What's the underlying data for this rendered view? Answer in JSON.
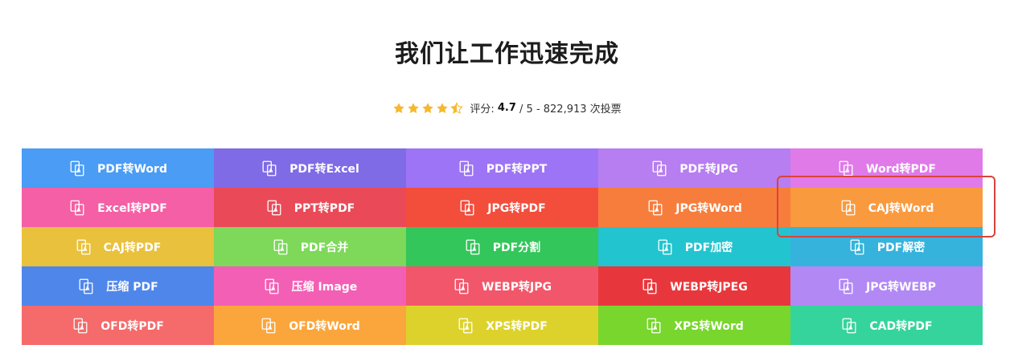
{
  "header": {
    "title": "我们让工作迅速完成"
  },
  "rating": {
    "stars": 4.5,
    "label": "评分:",
    "score": "4.7",
    "out_of": "/ 5 - 822,913 次投票"
  },
  "tools": [
    {
      "label": "PDF转Word",
      "color": "#4a9cf5",
      "icon": "pdf-to-word-icon"
    },
    {
      "label": "PDF转Excel",
      "color": "#7f6be6",
      "icon": "pdf-to-excel-icon"
    },
    {
      "label": "PDF转PPT",
      "color": "#9d74f5",
      "icon": "pdf-to-ppt-icon"
    },
    {
      "label": "PDF转JPG",
      "color": "#b67ef0",
      "icon": "pdf-to-jpg-icon"
    },
    {
      "label": "Word转PDF",
      "color": "#e07ae8",
      "icon": "word-to-pdf-icon"
    },
    {
      "label": "Excel转PDF",
      "color": "#f45fa5",
      "icon": "excel-to-pdf-icon"
    },
    {
      "label": "PPT转PDF",
      "color": "#ea4a58",
      "icon": "ppt-to-pdf-icon"
    },
    {
      "label": "JPG转PDF",
      "color": "#f34d3c",
      "icon": "jpg-to-pdf-icon"
    },
    {
      "label": "JPG转Word",
      "color": "#f77d3c",
      "icon": "jpg-to-word-icon"
    },
    {
      "label": "CAJ转Word",
      "color": "#fa9a3e",
      "icon": "caj-to-word-icon"
    },
    {
      "label": "CAJ转PDF",
      "color": "#e9c13d",
      "icon": "caj-to-pdf-icon"
    },
    {
      "label": "PDF合并",
      "color": "#7ed85a",
      "icon": "pdf-merge-icon"
    },
    {
      "label": "PDF分割",
      "color": "#33c65a",
      "icon": "pdf-split-icon"
    },
    {
      "label": "PDF加密",
      "color": "#22c4cf",
      "icon": "pdf-encrypt-icon"
    },
    {
      "label": "PDF解密",
      "color": "#35b3dc",
      "icon": "pdf-decrypt-icon"
    },
    {
      "label": "压缩 PDF",
      "color": "#4f86ea",
      "icon": "compress-pdf-icon"
    },
    {
      "label": "压缩 Image",
      "color": "#f35fb4",
      "icon": "compress-image-icon"
    },
    {
      "label": "WEBP转JPG",
      "color": "#f2566a",
      "icon": "webp-to-jpg-icon"
    },
    {
      "label": "WEBP转JPEG",
      "color": "#e8373c",
      "icon": "webp-to-jpeg-icon"
    },
    {
      "label": "JPG转WEBP",
      "color": "#b288f5",
      "icon": "jpg-to-webp-icon"
    },
    {
      "label": "OFD转PDF",
      "color": "#f56a6a",
      "icon": "ofd-to-pdf-icon"
    },
    {
      "label": "OFD转Word",
      "color": "#fba63c",
      "icon": "ofd-to-word-icon"
    },
    {
      "label": "XPS转PDF",
      "color": "#ddd22c",
      "icon": "xps-to-pdf-icon"
    },
    {
      "label": "XPS转Word",
      "color": "#78d62c",
      "icon": "xps-to-word-icon"
    },
    {
      "label": "CAD转PDF",
      "color": "#35d49c",
      "icon": "cad-to-pdf-icon"
    }
  ],
  "highlighted_tool": "CAJ转Word"
}
